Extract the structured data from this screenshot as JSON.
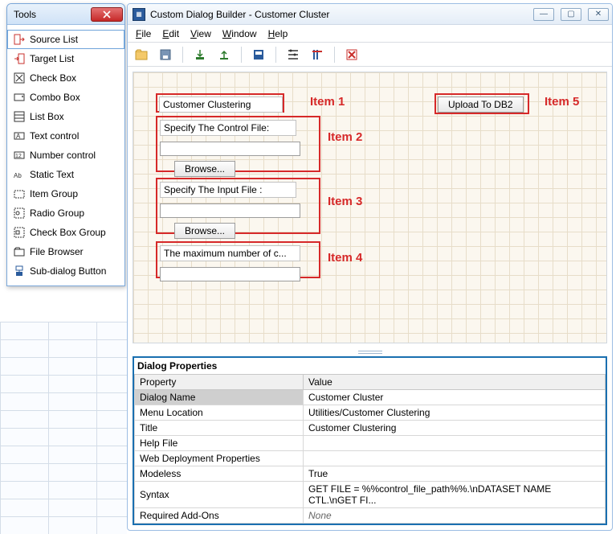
{
  "tools_window": {
    "title": "Tools",
    "items": [
      {
        "label": "Source List",
        "icon": "source-list-icon"
      },
      {
        "label": "Target List",
        "icon": "target-list-icon"
      },
      {
        "label": "Check Box",
        "icon": "checkbox-icon"
      },
      {
        "label": "Combo Box",
        "icon": "combobox-icon"
      },
      {
        "label": "List Box",
        "icon": "listbox-icon"
      },
      {
        "label": "Text control",
        "icon": "text-control-icon"
      },
      {
        "label": "Number control",
        "icon": "number-control-icon"
      },
      {
        "label": "Static Text",
        "icon": "static-text-icon"
      },
      {
        "label": "Item Group",
        "icon": "item-group-icon"
      },
      {
        "label": "Radio Group",
        "icon": "radio-group-icon"
      },
      {
        "label": "Check Box Group",
        "icon": "checkbox-group-icon"
      },
      {
        "label": "File Browser",
        "icon": "file-browser-icon"
      },
      {
        "label": "Sub-dialog Button",
        "icon": "subdialog-icon"
      }
    ]
  },
  "main_window": {
    "title": "Custom Dialog Builder - Customer Cluster",
    "menu": {
      "file": "File",
      "edit": "Edit",
      "view": "View",
      "window": "Window",
      "help": "Help"
    }
  },
  "annotations": {
    "item1": "Item 1",
    "item2": "Item 2",
    "item3": "Item 3",
    "item4": "Item 4",
    "item5": "Item 5"
  },
  "canvas": {
    "title_text": "Customer Clustering",
    "control_file_label": "Specify The Control File:",
    "input_file_label": "Specify The Input File :",
    "max_label": "The maximum number of c...",
    "browse_label": "Browse...",
    "upload_label": "Upload To DB2"
  },
  "properties": {
    "panel_title": "Dialog Properties",
    "headers": {
      "prop": "Property",
      "val": "Value"
    },
    "rows": [
      {
        "name": "Dialog Name",
        "value": "Customer Cluster",
        "sel": true
      },
      {
        "name": "Menu Location",
        "value": "Utilities/Customer Clustering"
      },
      {
        "name": "Title",
        "value": "Customer Clustering"
      },
      {
        "name": "Help File",
        "value": ""
      },
      {
        "name": "Web Deployment Properties",
        "value": ""
      },
      {
        "name": "Modeless",
        "value": "True"
      },
      {
        "name": "Syntax",
        "value": "GET FILE = %%control_file_path%%.\\nDATASET NAME CTL.\\nGET FI..."
      },
      {
        "name": "Required Add-Ons",
        "value": "None",
        "italic": true
      }
    ]
  }
}
